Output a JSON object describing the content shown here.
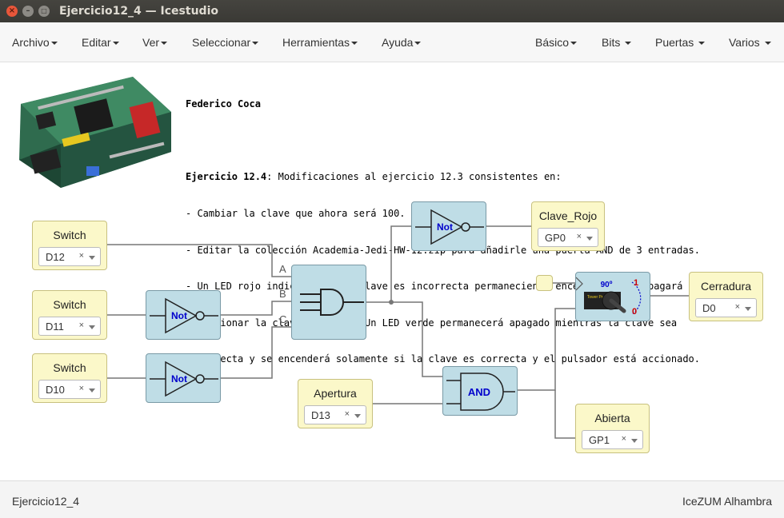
{
  "window": {
    "title": "Ejercicio12_4 — Icestudio"
  },
  "menu_left": [
    "Archivo",
    "Editar",
    "Ver",
    "Seleccionar",
    "Herramientas",
    "Ayuda"
  ],
  "menu_right": [
    "Básico",
    "Bits",
    "Puertas",
    "Varios"
  ],
  "notes": {
    "author": "Federico Coca",
    "heading": "Ejercicio 12.4",
    "heading_rest": ": Modificaciones al ejercicio 12.3 consistentes en:",
    "lines": [
      "- Cambiar la clave que ahora será 100.",
      "- Editar la colección Academia-Jedi-HW-12.zip para añadirle una puerta AND de 3 entradas.",
      "- Un LED rojo indicará que la clave es incorrecta permaneciendo encendido y se apagará al",
      "seleccionar la clave correcta. Un LED verde permanecerá apagado mientras la clave sea",
      "incorrecta y se encenderá solamente si la clave es correcta y el pulsador está accionado."
    ]
  },
  "inputs": {
    "switch1": {
      "label": "Switch",
      "pin": "D12",
      "clear": "×"
    },
    "switch2": {
      "label": "Switch",
      "pin": "D11",
      "clear": "×"
    },
    "switch3": {
      "label": "Switch",
      "pin": "D10",
      "clear": "×"
    },
    "apertura": {
      "label": "Apertura",
      "pin": "D13",
      "clear": "×"
    }
  },
  "outputs": {
    "clave_rojo": {
      "label": "Clave_Rojo",
      "pin": "GP0",
      "clear": "×"
    },
    "cerradura": {
      "label": "Cerradura",
      "pin": "D0",
      "clear": "×"
    },
    "abierta": {
      "label": "Abierta",
      "pin": "GP1",
      "clear": "×"
    }
  },
  "gates": {
    "not_label": "Not",
    "and_label": "AND",
    "and3_pins": [
      "A",
      "B",
      "C"
    ]
  },
  "servo": {
    "angle": "90º",
    "top_label": "1",
    "bottom_label": "0",
    "brand": "Tower Pro SG-90"
  },
  "status": {
    "left": "Ejercicio12_4",
    "right": "IceZUM Alhambra"
  },
  "colors": {
    "block": "#bfdde6",
    "io": "#fbf8c9",
    "not_text": "#0000cc",
    "wire": "#777777"
  }
}
